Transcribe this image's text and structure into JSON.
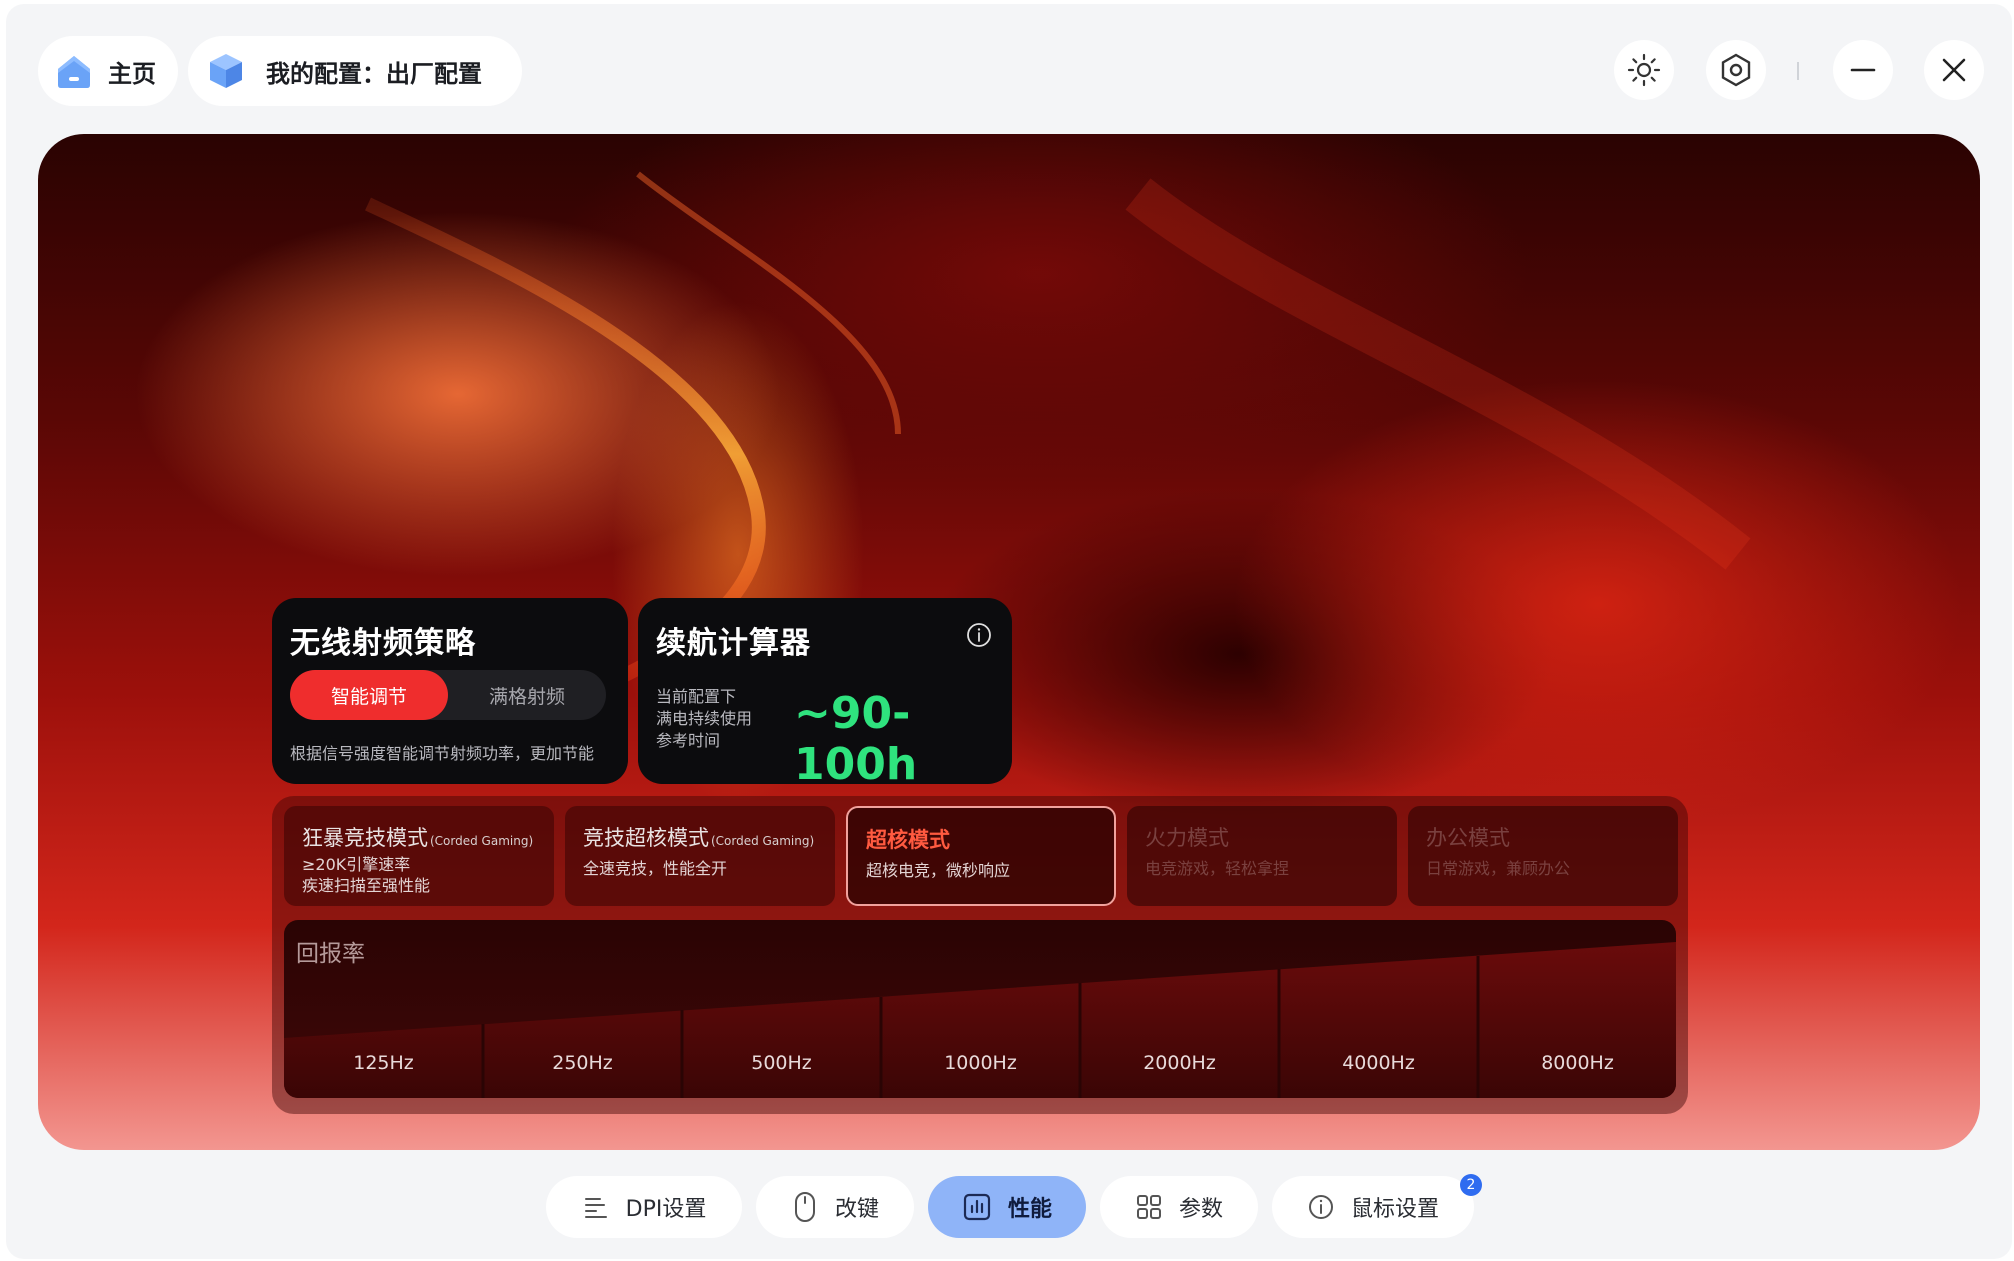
{
  "header": {
    "home_label": "主页",
    "config_label": "我的配置：出厂配置",
    "icons": [
      "home-icon",
      "cube-icon",
      "brightness-icon",
      "settings-hex-icon",
      "minimize-icon",
      "close-icon"
    ]
  },
  "rf_card": {
    "title": "无线射频策略",
    "options": [
      "智能调节",
      "满格射频"
    ],
    "selected": "智能调节",
    "description": "根据信号强度智能调节射频功率，更加节能"
  },
  "battery_card": {
    "title": "续航计算器",
    "desc_lines": [
      "当前配置下",
      "满电持续使用",
      "参考时间"
    ],
    "value": "~90-100h"
  },
  "modes": [
    {
      "title": "狂暴竞技模式",
      "tag": "(Corded Gaming)",
      "desc": [
        "≥20K引擎速率",
        "疾速扫描至强性能"
      ],
      "state": "normal"
    },
    {
      "title": "竞技超核模式",
      "tag": "(Corded Gaming)",
      "desc": [
        "全速竞技，性能全开"
      ],
      "state": "normal"
    },
    {
      "title": "超核模式",
      "tag": "",
      "desc": [
        "超核电竞，微秒响应"
      ],
      "state": "selected"
    },
    {
      "title": "火力模式",
      "tag": "",
      "desc": [
        "电竞游戏，轻松拿捏"
      ],
      "state": "dim"
    },
    {
      "title": "办公模式",
      "tag": "",
      "desc": [
        "日常游戏，兼顾办公"
      ],
      "state": "dim"
    }
  ],
  "polling": {
    "label": "回报率",
    "rates": [
      "125Hz",
      "250Hz",
      "500Hz",
      "1000Hz",
      "2000Hz",
      "4000Hz",
      "8000Hz"
    ]
  },
  "bottom_nav": {
    "items": [
      "DPI设置",
      "改键",
      "性能",
      "参数",
      "鼠标设置"
    ],
    "active": "性能",
    "badge": "2"
  },
  "colors": {
    "accent_red": "#ef2d2d",
    "battery_green": "#2fe37e",
    "nav_active": "#8fb4f8",
    "badge_blue": "#2f6cf0"
  }
}
